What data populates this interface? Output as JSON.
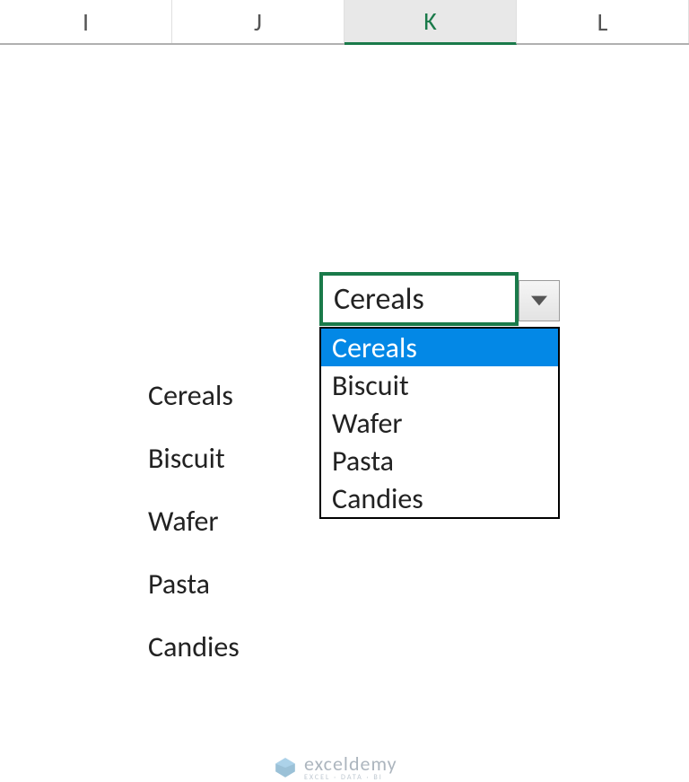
{
  "columns": {
    "col0": "I",
    "col1": "J",
    "col2": "K",
    "col3": "L"
  },
  "source_list": {
    "item0": "Cereals",
    "item1": "Biscuit",
    "item2": "Wafer",
    "item3": "Pasta",
    "item4": "Candies"
  },
  "selected_cell_value": "Cereals",
  "dropdown": {
    "opt0": "Cereals",
    "opt1": "Biscuit",
    "opt2": "Wafer",
    "opt3": "Pasta",
    "opt4": "Candies"
  },
  "watermark": {
    "name": "exceldemy",
    "tagline": "EXCEL · DATA · BI"
  }
}
